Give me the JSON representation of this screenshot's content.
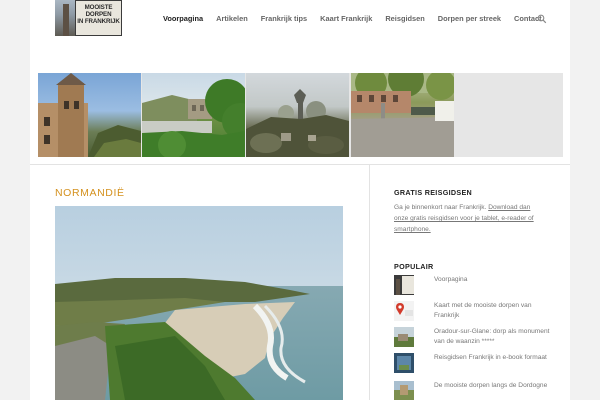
{
  "header": {
    "logo_lines": [
      "MOOISTE",
      "DORPEN",
      "IN FRANKRIJK"
    ],
    "nav": [
      {
        "label": "Voorpagina",
        "active": true
      },
      {
        "label": "Artikelen",
        "active": false
      },
      {
        "label": "Frankrijk tips",
        "active": false
      },
      {
        "label": "Kaart Frankrijk",
        "active": false
      },
      {
        "label": "Reisgidsen",
        "active": false
      },
      {
        "label": "Dorpen per streek",
        "active": false
      },
      {
        "label": "Contact",
        "active": false
      }
    ],
    "search_icon": "search-icon"
  },
  "main": {
    "post_title": "NORMANDIË"
  },
  "sidebar": {
    "guides": {
      "title": "GRATIS REISGIDSEN",
      "text_prefix": "Ga je binnenkort naar Frankrijk. ",
      "link_text": "Download dan onze gratis reisgidsen voor je tablet, e-reader of smartphone."
    },
    "popular": {
      "title": "POPULAIR",
      "items": [
        {
          "label": "Voorpagina"
        },
        {
          "label": "Kaart met de mooiste dorpen van Frankrijk"
        },
        {
          "label": "Oradour-sur-Glane: dorp als monument van de waanzin *****"
        },
        {
          "label": "Reisgidsen Frankrijk in e-book formaat"
        },
        {
          "label": "De mooiste dorpen langs de Dordogne"
        }
      ]
    }
  },
  "colors": {
    "accent": "#d4911e",
    "text": "#777777",
    "nav_active": "#222222"
  }
}
